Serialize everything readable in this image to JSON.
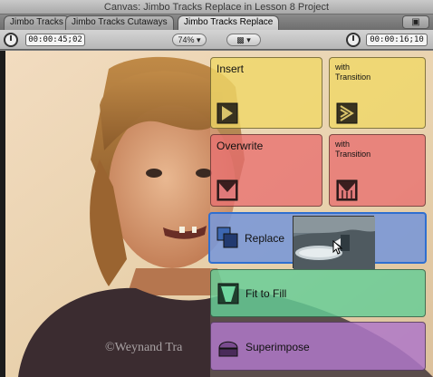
{
  "window": {
    "title": "Canvas: Jimbo Tracks Replace in Lesson 8 Project"
  },
  "tabs": [
    {
      "label": "Jimbo Tracks"
    },
    {
      "label": "Jimbo Tracks Cutaways"
    },
    {
      "label": "Jimbo Tracks Replace"
    }
  ],
  "toolbar": {
    "timecode_left": "00:00:45;02",
    "zoom": "74%",
    "timecode_right": "00:00:16;10"
  },
  "overlay": {
    "insert": {
      "label": "Insert"
    },
    "insert_with_transition": {
      "line1": "with",
      "line2": "Transition"
    },
    "overwrite": {
      "label": "Overwrite"
    },
    "overwrite_with_transition": {
      "line1": "with",
      "line2": "Transition"
    },
    "replace": {
      "label": "Replace"
    },
    "fit_to_fill": {
      "label": "Fit to Fill"
    },
    "superimpose": {
      "label": "Superimpose"
    }
  },
  "watermark": {
    "text": "©Weynand Tra"
  },
  "colors": {
    "insert": "#f0d764",
    "overwrite": "#e86e6e",
    "replace": "#7896d7",
    "fit_to_fill": "#64cd96",
    "superimpose": "#af78c8",
    "replace_border": "#2f6fd0"
  }
}
